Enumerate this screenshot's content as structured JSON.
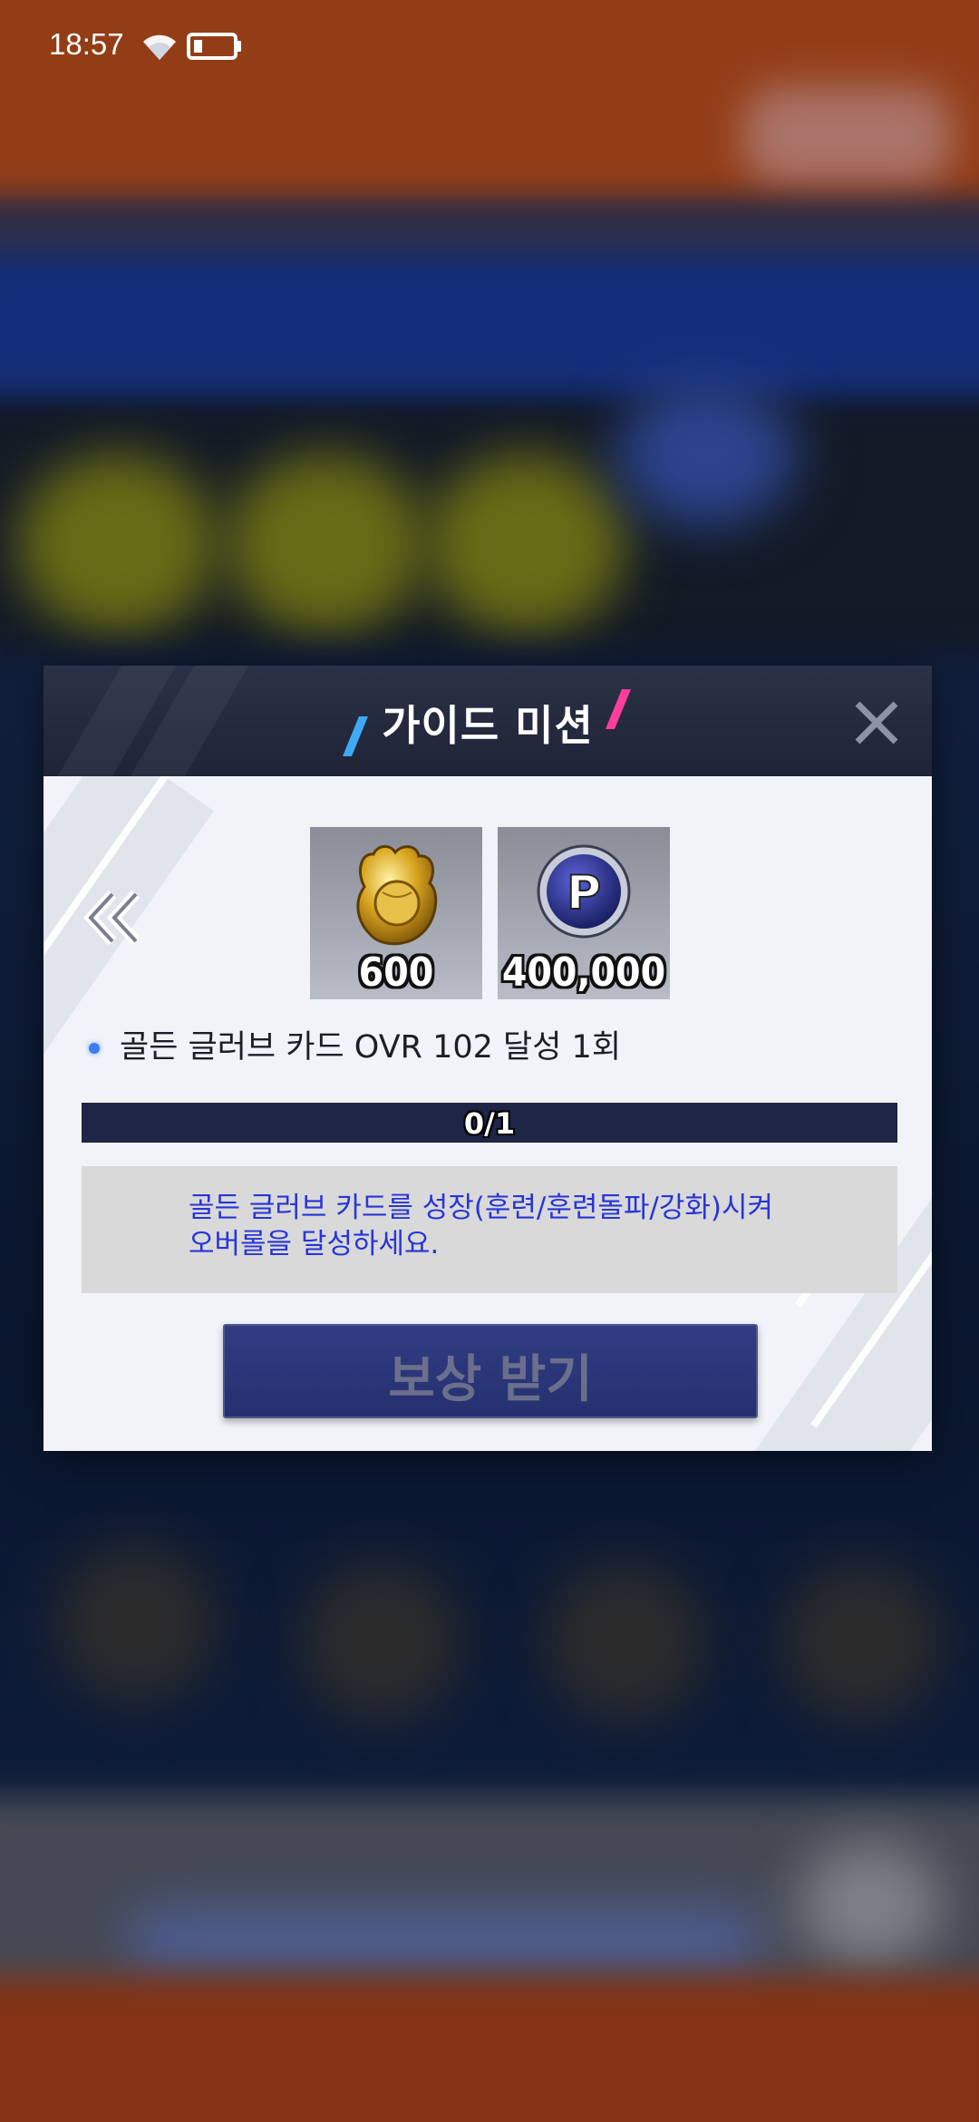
{
  "status_bar": {
    "time": "18:57",
    "wifi_icon": "wifi-icon",
    "battery_icon": "battery-low-icon"
  },
  "dialog": {
    "title": "가이드 미션",
    "close_icon": "close-icon",
    "prev_icon": "double-chevron-left-icon",
    "rewards": [
      {
        "icon": "golden-glove-icon",
        "amount": "600"
      },
      {
        "icon": "p-coin-icon",
        "amount": "400,000"
      }
    ],
    "mission": {
      "text": "골든 글러브 카드 OVR 102 달성 1회",
      "progress_text": "0/1",
      "progress_value": 0
    },
    "description_line1": "골든 글러브 카드를 성장(훈련/훈련돌파/강화)시켜",
    "description_line2": "오버롤을 달성하세요.",
    "claim_button": "보상 받기"
  },
  "colors": {
    "header_bg": "#262b40",
    "body_bg": "#f1f3f8",
    "progress_bg": "#1e2546",
    "description_text": "#2835d6",
    "claim_button_bg": "#2b357a",
    "slash_left": "#3fa9f5",
    "slash_right": "#ff3d9a"
  }
}
